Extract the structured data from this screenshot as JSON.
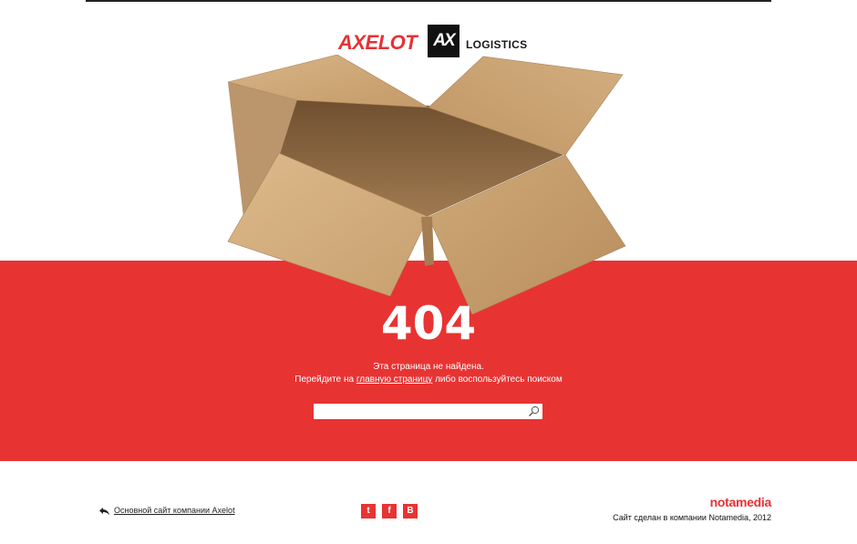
{
  "header": {
    "logo_word": "AXELOT",
    "logo_mark": "AX",
    "logo_sub": "LOGISTICS"
  },
  "error": {
    "code": "404",
    "line1": "Эта страница не найдена.",
    "line2_before": "Перейдите на ",
    "line2_link": "главную страницу",
    "line2_after": " либо воспользуйтесь поиском"
  },
  "search": {
    "value": "",
    "placeholder": "",
    "button_icon": "search-icon"
  },
  "footer": {
    "main_site_link": "Основной сайт компании Axelot",
    "social": [
      {
        "icon": "twitter-icon",
        "glyph": "t"
      },
      {
        "icon": "facebook-icon",
        "glyph": "f"
      },
      {
        "icon": "vkontakte-icon",
        "glyph": "В"
      }
    ],
    "credit_logo": "notamedia",
    "credit_text": "Сайт сделан в компании Notamedia, 2012"
  },
  "colors": {
    "brand_red": "#e83333",
    "dark": "#111111",
    "cardboard": "#c9a06f"
  }
}
